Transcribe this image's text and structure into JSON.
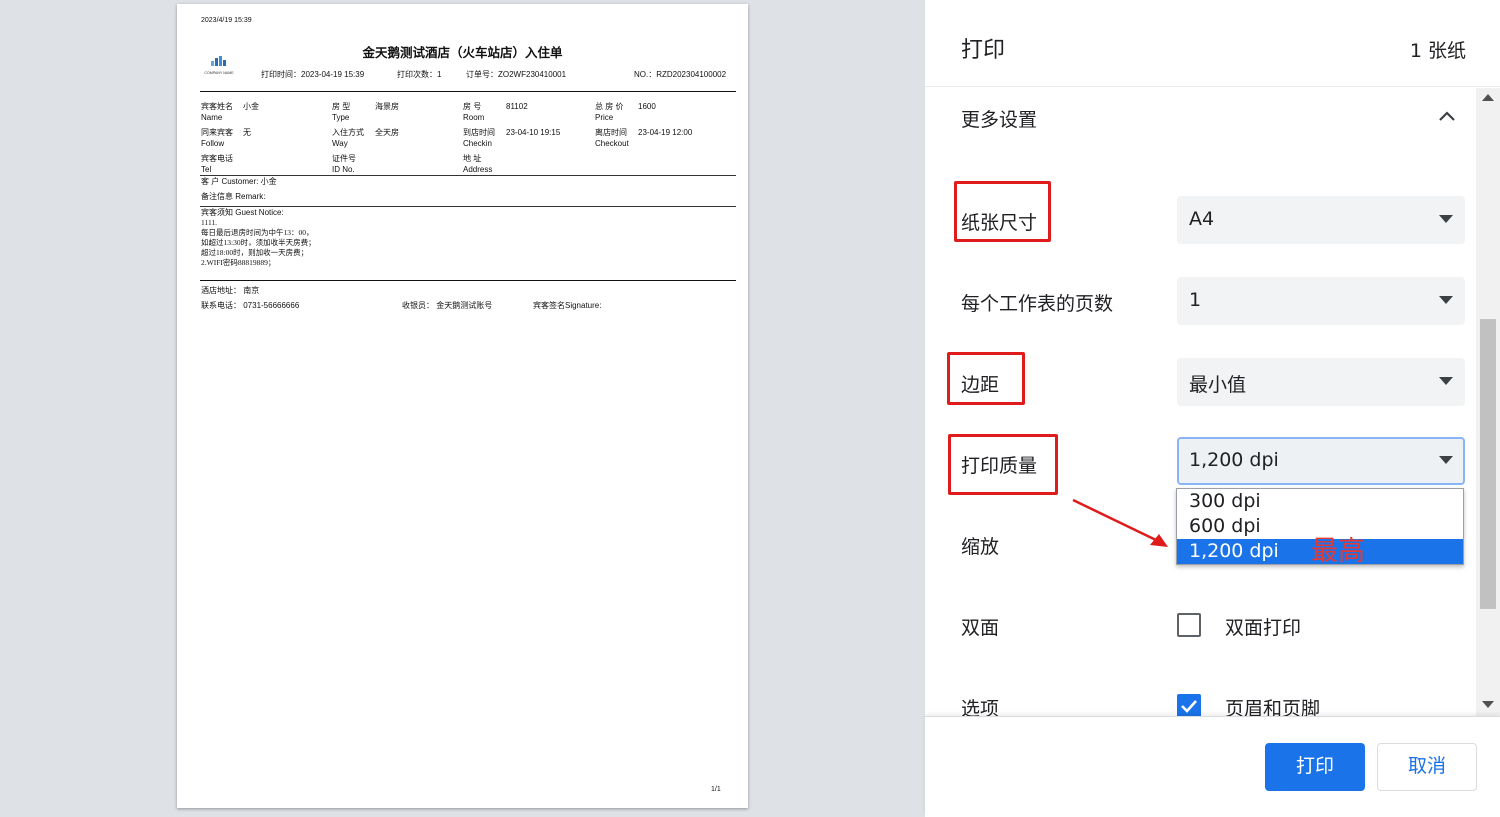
{
  "preview": {
    "timestamp": "2023/4/19 15:39",
    "title": "金天鹅测试酒店（火车站店）入住单",
    "logo_text": "COMPANY NAME",
    "meta": {
      "print_time": "打印时间：2023-04-19 15:39",
      "print_count": "打印次数：1",
      "order_no": "订单号：ZO2WF230410001",
      "no": "NO.：RZD202304100002"
    },
    "fields": {
      "guest_name_cn": "宾客姓名",
      "guest_name_en": "Name",
      "guest_name_val": "小金",
      "room_type_cn": "房 型",
      "room_type_en": "Type",
      "room_type_val": "海景房",
      "room_no_cn": "房 号",
      "room_no_en": "Room",
      "room_no_val": "81102",
      "price_cn": "总 房 价",
      "price_en": "Price",
      "price_val": "1600",
      "follow_cn": "同来宾客",
      "follow_en": "Follow",
      "follow_val": "无",
      "way_cn": "入住方式",
      "way_en": "Way",
      "way_val": "全天房",
      "checkin_cn": "到店时间",
      "checkin_en": "Checkin",
      "checkin_val": "23-04-10 19:15",
      "checkout_cn": "离店时间",
      "checkout_en": "Checkout",
      "checkout_val": "23-04-19 12:00",
      "tel_cn": "宾客电话",
      "tel_en": "Tel",
      "id_cn": "证件号",
      "id_en": "ID No.",
      "addr_cn": "地 址",
      "addr_en": "Address"
    },
    "customer": "客 户 Customer: 小金",
    "remark": "备注信息 Remark:",
    "notice_title": "宾客须知 Guest Notice:",
    "notice_lines": [
      "1111.",
      "每日最后退房时间为中午13：00，",
      "如超过13:30时，须加收半天房费；",
      "超过18:00时，则加收一天房费；",
      "2.WIFI密码88819889；"
    ],
    "hotel_addr": "酒店地址：  南京",
    "phone": "联系电话：  0731-56666666",
    "cashier": "收银员：    金天鹅测试账号",
    "signature": "宾客签名Signature:",
    "page_num": "1/1"
  },
  "panel": {
    "title": "打印",
    "sheet_count": "1 张纸",
    "more_settings": "更多设置",
    "paper_size": {
      "label": "纸张尺寸",
      "value": "A4"
    },
    "pages_per_sheet": {
      "label": "每个工作表的页数",
      "value": "1"
    },
    "margins": {
      "label": "边距",
      "value": "最小值"
    },
    "quality": {
      "label": "打印质量",
      "value": "1,200 dpi",
      "options": [
        "300 dpi",
        "600 dpi",
        "1,200 dpi"
      ],
      "selected_index": 2,
      "annotation": "最高"
    },
    "scale": {
      "label": "缩放"
    },
    "duplex": {
      "label": "双面",
      "checkbox_label": "双面打印",
      "checked": false
    },
    "options": {
      "label": "选项",
      "checkbox_label": "页眉和页脚",
      "checked": true
    },
    "print_button": "打印",
    "cancel_button": "取消"
  },
  "colors": {
    "accent": "#1a73e8",
    "annotation_red": "#e01b1b",
    "preview_bg": "#dee1e6"
  }
}
